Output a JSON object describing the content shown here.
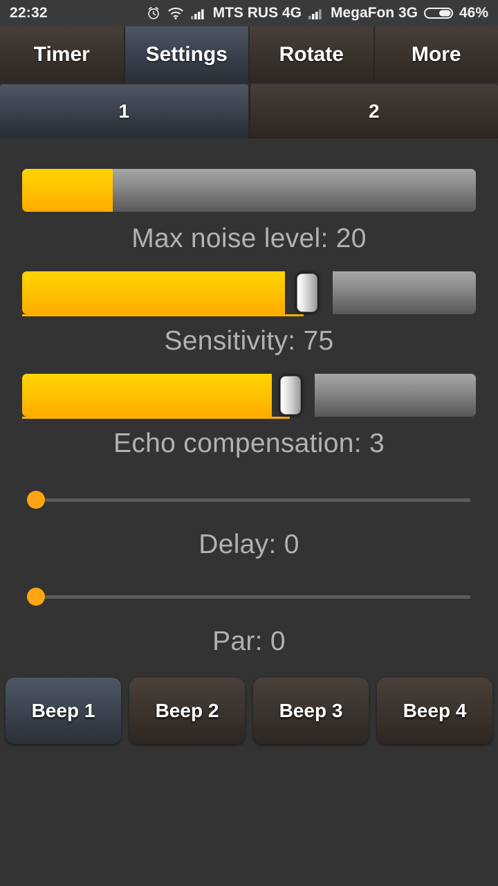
{
  "status_bar": {
    "clock": "22:32",
    "alarm_icon": "alarm-clock-icon",
    "wifi_icon": "wifi-icon",
    "signal_icon_1": "signal-bars-icon",
    "carrier_1": "MTS RUS 4G",
    "signal_icon_2": "signal-bars-icon",
    "carrier_2": "MegaFon 3G",
    "battery_icon": "battery-icon",
    "battery_percent": "46%"
  },
  "tabs": [
    {
      "label": "Timer",
      "active": false
    },
    {
      "label": "Settings",
      "active": true
    },
    {
      "label": "Rotate",
      "active": false
    },
    {
      "label": "More",
      "active": false
    }
  ],
  "subtabs": [
    {
      "label": "1",
      "active": true
    },
    {
      "label": "2",
      "active": false
    }
  ],
  "sliders": [
    {
      "name": "max-noise-level",
      "label": "Max noise level: 20",
      "value": 20,
      "style": "bar",
      "fill_percent": 20,
      "show_thumb": false
    },
    {
      "name": "sensitivity",
      "label": "Sensitivity: 75",
      "value": 75,
      "style": "bar",
      "fill_percent": 58,
      "show_thumb": true
    },
    {
      "name": "echo-compensation",
      "label": "Echo compensation: 3",
      "value": 3,
      "style": "bar",
      "fill_percent": 55,
      "show_thumb": true
    },
    {
      "name": "delay",
      "label": "Delay: 0",
      "value": 0,
      "style": "thin",
      "fill_percent": 0,
      "show_thumb": true
    },
    {
      "name": "par",
      "label": "Par: 0",
      "value": 0,
      "style": "thin",
      "fill_percent": 0,
      "show_thumb": true
    }
  ],
  "beep_buttons": [
    {
      "label": "Beep 1",
      "active": true
    },
    {
      "label": "Beep 2",
      "active": false
    },
    {
      "label": "Beep 3",
      "active": false
    },
    {
      "label": "Beep 4",
      "active": false
    }
  ],
  "colors": {
    "background": "#333333",
    "accent_yellow": "#ffc400",
    "accent_orange": "#ffa412",
    "active_tab": "#3c444f",
    "inactive_tab": "#3b332d",
    "label_text": "#b2b2b2"
  }
}
